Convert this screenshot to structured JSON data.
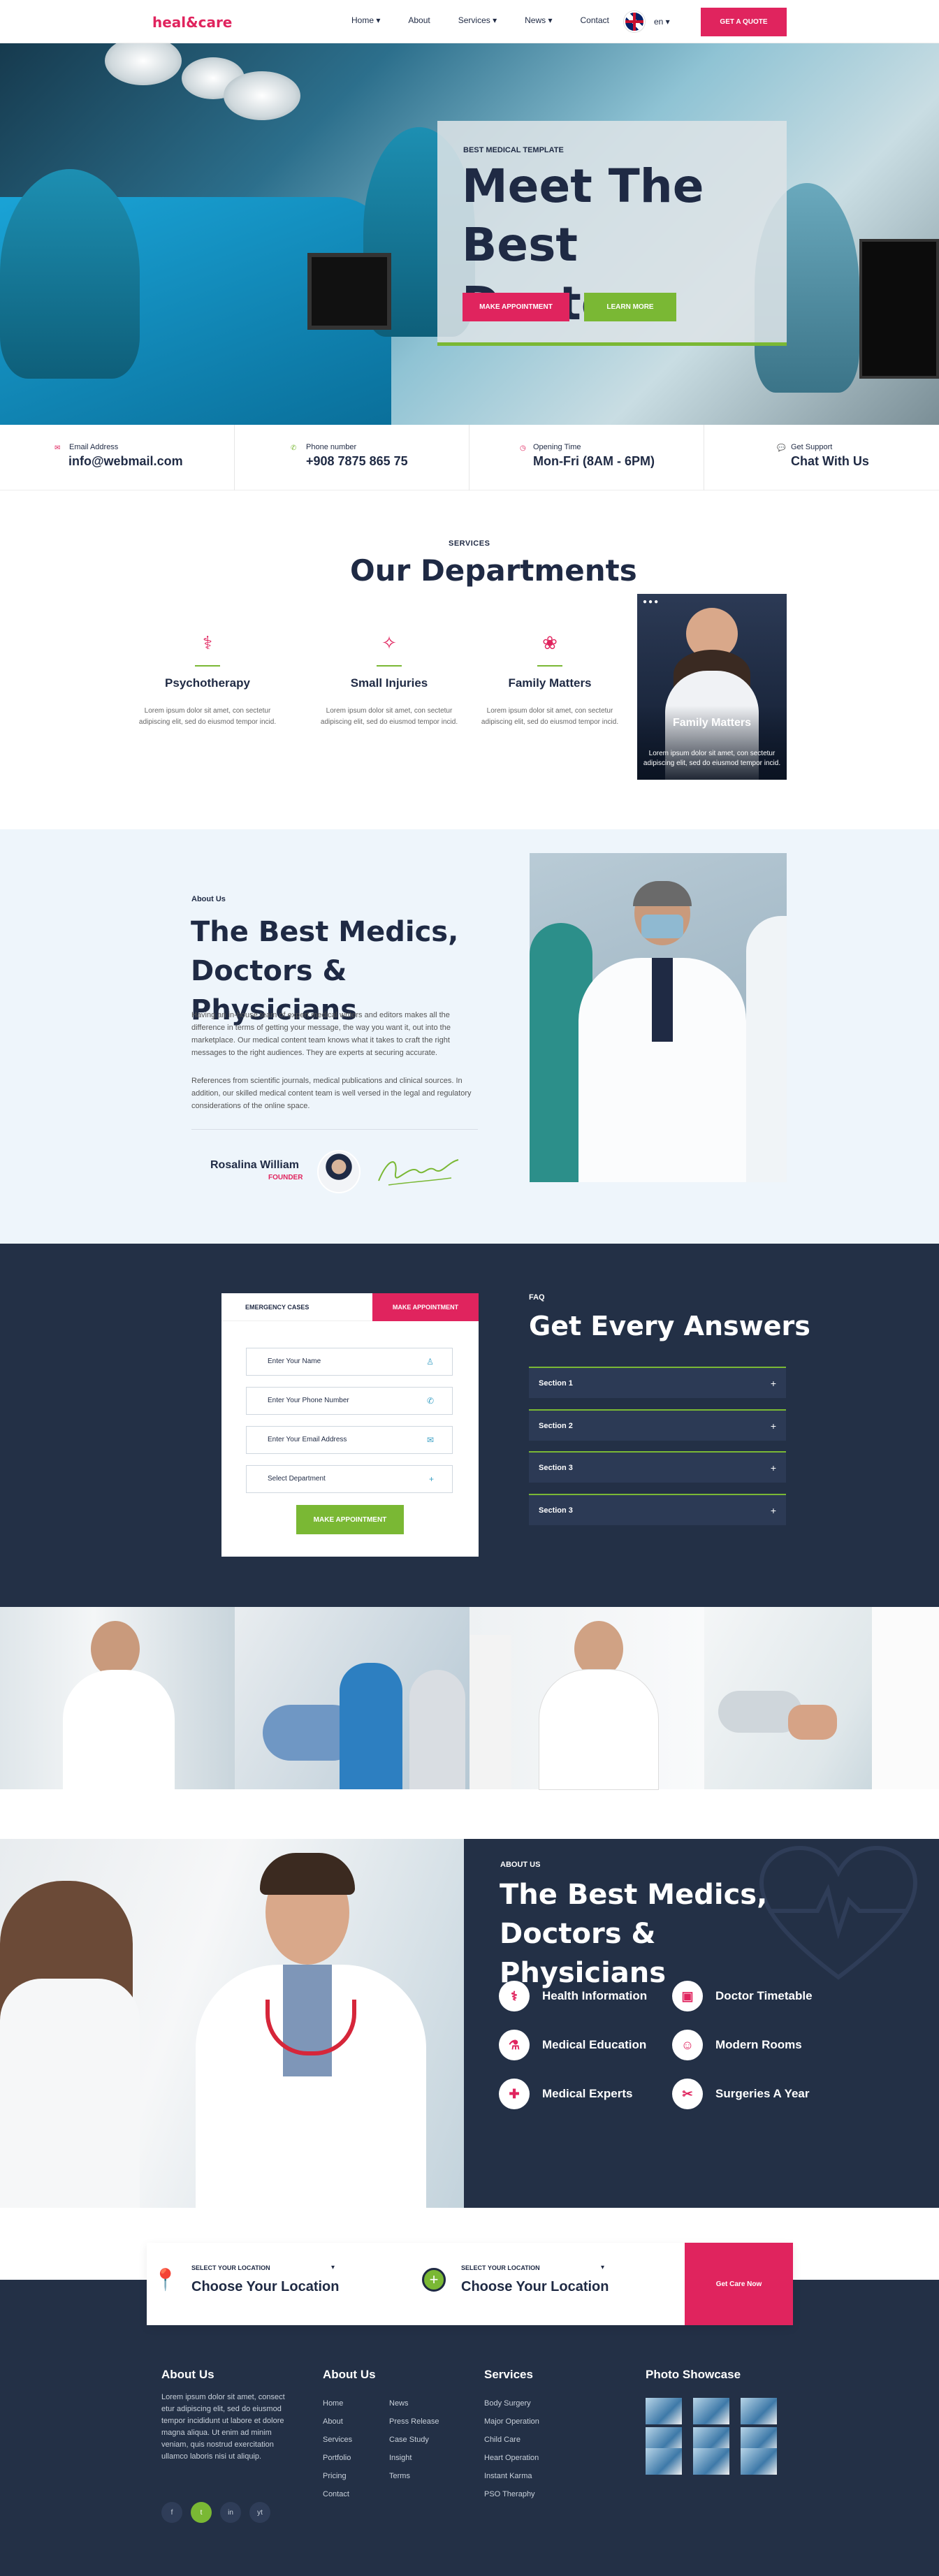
{
  "header": {
    "logo": "heal&care",
    "nav": [
      "Home ▾",
      "About",
      "Services ▾",
      "News ▾",
      "Contact"
    ],
    "lang": "en ▾",
    "quote_btn": "GET A QUOTE"
  },
  "hero": {
    "small": "BEST MEDICAL TEMPLATE",
    "title": "Meet The Best Doctors",
    "btn_appointment": "MAKE APPOINTMENT",
    "btn_learn": "LEARN MORE"
  },
  "info": [
    {
      "label": "Email Address",
      "value": "info@webmail.com",
      "icon": "mail-icon"
    },
    {
      "label": "Phone number",
      "value": "+908 7875 865 75",
      "icon": "phone-icon"
    },
    {
      "label": "Opening Time",
      "value": "Mon-Fri (8AM - 6PM)",
      "icon": "clock-icon"
    },
    {
      "label": "Get Support",
      "value": "Chat With Us",
      "icon": "chat-icon"
    }
  ],
  "departments": {
    "small": "SERVICES",
    "title": "Our Departments",
    "items": [
      {
        "name": "Psychotherapy",
        "text": "Lorem ipsum dolor sit amet, con sectetur adipiscing elit, sed do eiusmod tempor incid."
      },
      {
        "name": "Small Injuries",
        "text": "Lorem ipsum dolor sit amet, con sectetur adipiscing elit, sed do eiusmod tempor incid."
      },
      {
        "name": "Family Matters",
        "text": "Lorem ipsum dolor sit amet, con sectetur adipiscing elit, sed do eiusmod tempor incid."
      }
    ],
    "card": {
      "name": "Family Matters",
      "text": "Lorem ipsum dolor sit amet, con sectetur adipiscing elit, sed do eiusmod tempor incid."
    }
  },
  "about": {
    "small": "About Us",
    "title": "The Best Medics, Doctors & Physicians",
    "p1": "Having an in-house team of expert medical writers and editors makes all the difference in terms of getting your message, the way you want it, out into the marketplace. Our medical content team knows what it takes to craft the right messages to the right audiences. They are experts at securing accurate.",
    "p2": "References from scientific journals, medical publications and clinical sources. In addition, our skilled medical content team is well versed in the legal and regulatory considerations of the online space.",
    "name": "Rosalina William",
    "role": "FOUNDER"
  },
  "form": {
    "tab1": "EMERGENCY CASES",
    "tab2": "MAKE APPOINTMENT",
    "name": "Enter Your Name",
    "phone": "Enter Your Phone Number",
    "email": "Enter Your Email Address",
    "dept": "Select Department",
    "submit": "MAKE APPOINTMENT"
  },
  "faq": {
    "small": "FAQ",
    "title": "Get Every Answers",
    "items": [
      "Section 1",
      "Section 2",
      "Section 3",
      "Section 3"
    ]
  },
  "about2": {
    "small": "ABOUT US",
    "title": "The Best Medics, Doctors & Physicians",
    "features": [
      "Health Information",
      "Doctor Timetable",
      "Medical Education",
      "Modern Rooms",
      "Medical Experts",
      "Surgeries A Year"
    ]
  },
  "location": {
    "label": "SELECT YOUR LOCATION",
    "title": "Choose Your Location",
    "btn": "Get Care Now"
  },
  "footer": {
    "about_title": "About Us",
    "about_text": "Lorem ipsum dolor sit amet, consect etur adipiscing elit, sed do eiusmod tempor incididunt ut labore et dolore magna aliqua. Ut enim ad minim veniam, quis nostrud exercitation ullamco laboris nisi ut aliquip.",
    "links_title": "About Us",
    "links1": [
      "Home",
      "About",
      "Services",
      "Portfolio",
      "Pricing",
      "Contact"
    ],
    "links2": [
      "News",
      "Press Release",
      "Case Study",
      "Insight",
      "Terms"
    ],
    "services_title": "Services",
    "services": [
      "Body Surgery",
      "Major Operation",
      "Child Care",
      "Heart Operation",
      "Instant Karma",
      "PSO Theraphy"
    ],
    "photo_title": "Photo Showcase",
    "social": [
      "f",
      "t",
      "in",
      "yt"
    ]
  }
}
